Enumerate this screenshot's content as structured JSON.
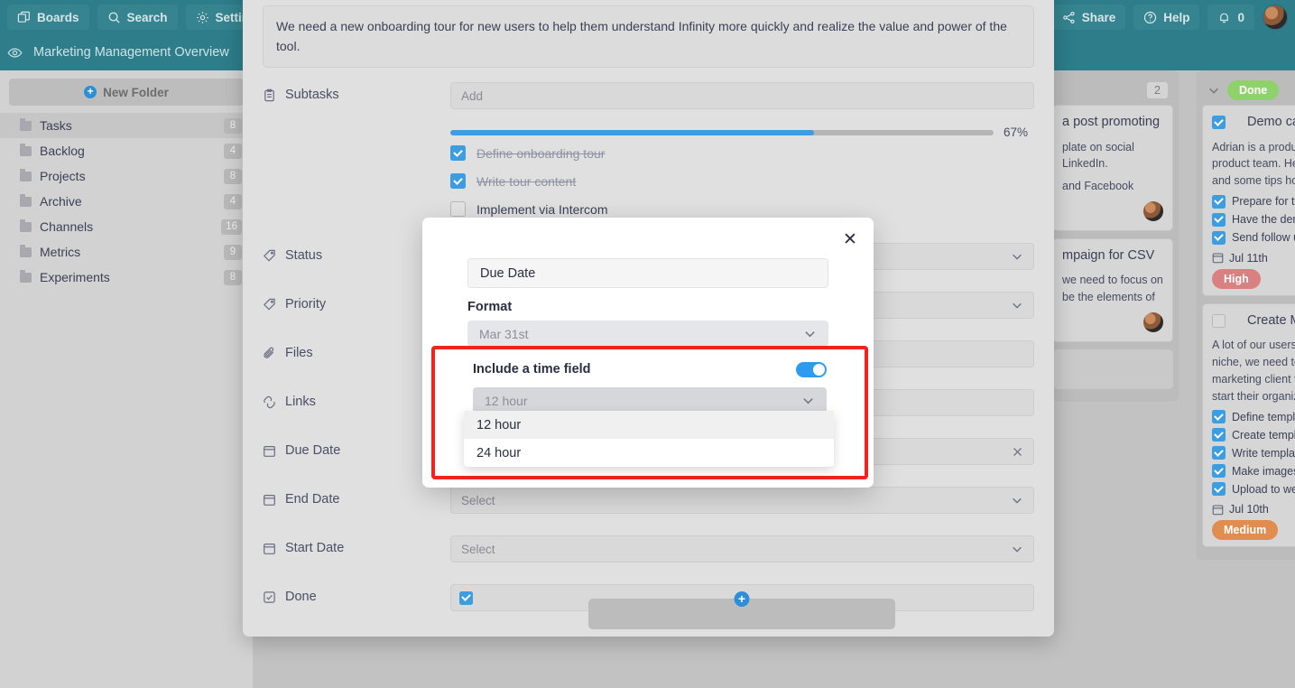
{
  "topbar": {
    "boards_label": "Boards",
    "search_label": "Search",
    "settings_label": "Settings",
    "share_label": "Share",
    "help_label": "Help",
    "notification_count": "0"
  },
  "boardbar": {
    "title": "Marketing Management Overview"
  },
  "sidebar": {
    "new_folder_label": "New Folder",
    "new_folder_plus": "+",
    "folders": [
      {
        "name": "Tasks",
        "count": "8",
        "active": true
      },
      {
        "name": "Backlog",
        "count": "4",
        "active": false
      },
      {
        "name": "Projects",
        "count": "8",
        "active": false
      },
      {
        "name": "Archive",
        "count": "4",
        "active": false
      },
      {
        "name": "Channels",
        "count": "16",
        "active": false
      },
      {
        "name": "Metrics",
        "count": "9",
        "active": false
      },
      {
        "name": "Experiments",
        "count": "8",
        "active": false
      }
    ]
  },
  "panel": {
    "description": "We need a new onboarding tour for new users to help them understand Infinity more quickly and realize the value and power of the tool.",
    "subtasks_label": "Subtasks",
    "subtasks_add_placeholder": "Add",
    "progress_percent": "67%",
    "progress_value": 67,
    "subtasks": [
      {
        "label": "Define onboarding tour",
        "done": true
      },
      {
        "label": "Write tour content",
        "done": true
      },
      {
        "label": "Implement via Intercom",
        "done": false
      }
    ],
    "fields": [
      {
        "label": "Status",
        "icon": "tag-icon",
        "value": "",
        "control": "chevron"
      },
      {
        "label": "Priority",
        "icon": "tag-icon",
        "value": "",
        "control": "chevron"
      },
      {
        "label": "Files",
        "icon": "paperclip-icon",
        "value": "",
        "control": "none"
      },
      {
        "label": "Links",
        "icon": "link-icon",
        "value": "",
        "control": "none"
      },
      {
        "label": "Due Date",
        "icon": "calendar-icon",
        "value": "",
        "control": "clear"
      },
      {
        "label": "End Date",
        "icon": "calendar-icon",
        "value": "Select",
        "control": "chevron"
      },
      {
        "label": "Start Date",
        "icon": "calendar-icon",
        "value": "Select",
        "control": "chevron"
      },
      {
        "label": "Done",
        "icon": "checkbox-icon",
        "value": "",
        "control": "checkbox"
      }
    ],
    "fab_plus": "+"
  },
  "modal": {
    "close_label": "✕",
    "name_value": "Due Date",
    "format_label": "Format",
    "format_value": "Mar 31st",
    "time_field_label": "Include a time field",
    "time_toggle_on": true,
    "time_format_value": "12 hour",
    "time_format_options": [
      {
        "label": "12 hour",
        "highlighted": true
      },
      {
        "label": "24 hour",
        "highlighted": false
      }
    ]
  },
  "board": {
    "columns": [
      {
        "badge": "2",
        "badge_type": "count",
        "cards": [
          {
            "title": "a post promoting",
            "desc": "plate on social\nLinkedIn.",
            "desc2": "and Facebook",
            "has_avatar": true
          },
          {
            "title": "mpaign for CSV",
            "desc": "we need to focus on\nbe the elements of",
            "has_avatar": true
          }
        ]
      },
      {
        "badge": "Done",
        "badge_type": "pill",
        "badge_color": "#8fd16a",
        "cards": [
          {
            "checked": true,
            "title": "Demo call",
            "desc": "Adrian is a produc\nproduct team. He\nand some tips how",
            "subtasks": [
              "Prepare for th",
              "Have the dem",
              "Send follow up"
            ],
            "date": "Jul 11th",
            "priority": "High",
            "priority_color": "#d98080"
          },
          {
            "checked": false,
            "title": "Create Ma",
            "desc": "A lot of our users\nniche, we need to\nmarketing client t\nstart their organiz",
            "subtasks": [
              "Define templa",
              "Create templa",
              "Write template",
              "Make images",
              "Upload to web"
            ],
            "date": "Jul 10th",
            "priority": "Medium",
            "priority_color": "#e08d4f"
          }
        ]
      }
    ]
  },
  "colors": {
    "teal": "#2d7d8a",
    "accent_blue": "#3c9ee0",
    "highlight_red": "#f02222"
  }
}
